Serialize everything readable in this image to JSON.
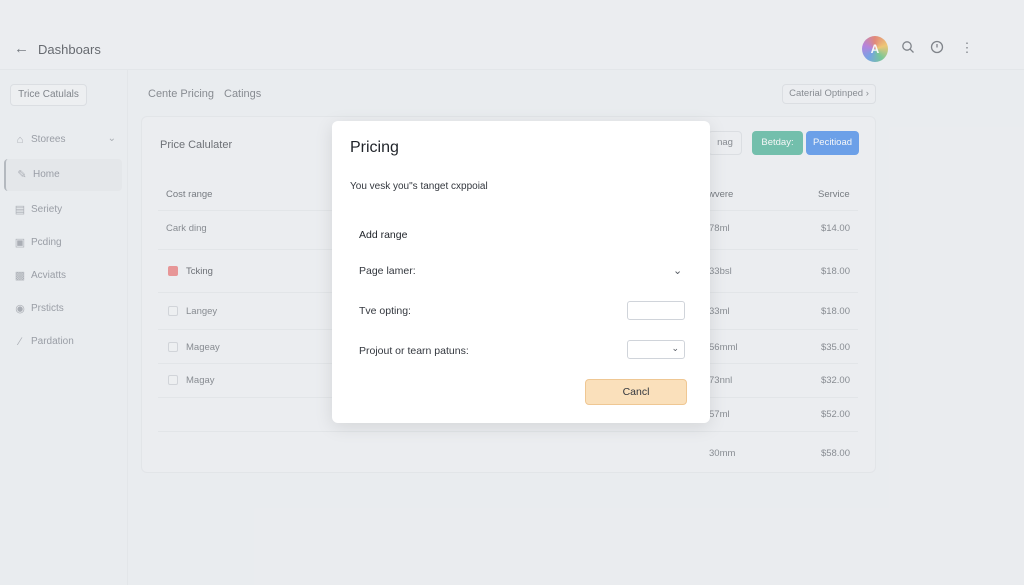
{
  "header": {
    "title": "Dashboars",
    "avatar_letter": "A",
    "icons": [
      "back-arrow-icon",
      "search-icon",
      "clock-icon",
      "more-vertical-icon"
    ]
  },
  "sidebar": {
    "search_label": "Trice Catulals",
    "items": [
      {
        "label": "Storees",
        "icon": "home-icon",
        "has_chevron": true
      },
      {
        "label": "Home",
        "icon": "pencil-icon",
        "active": true
      },
      {
        "label": "Seriety",
        "icon": "document-icon"
      },
      {
        "label": "Pcding",
        "icon": "calendar-icon"
      },
      {
        "label": "Acviatts",
        "icon": "chart-icon"
      },
      {
        "label": "Prsticts",
        "icon": "users-icon"
      },
      {
        "label": "Pardation",
        "icon": "wrench-icon"
      }
    ]
  },
  "subtabs": [
    "Cente Pricing",
    "Catings"
  ],
  "breadcrumb_button": "Caterial Optinped",
  "card": {
    "title": "Price Calulater",
    "buttons": {
      "ghost": "nag",
      "teal": "Betday:",
      "blue": "Pecitioad"
    },
    "columns": {
      "left": "Cost range",
      "middle": "wvere",
      "right": "Service"
    },
    "rows": [
      {
        "label": "Cark ding",
        "mid": "78ml",
        "price": "$14.00",
        "checkbox": "none"
      },
      {
        "label": "Tcking",
        "mid": "33bsl",
        "price": "$18.00",
        "checkbox": "red"
      },
      {
        "label": "Langey",
        "mid": "33ml",
        "price": "$18.00",
        "checkbox": "empty"
      },
      {
        "label": "Mageay",
        "mid": "56mml",
        "price": "$35.00",
        "checkbox": "empty"
      },
      {
        "label": "Magay",
        "mid": "73nnl",
        "price": "$32.00",
        "checkbox": "empty"
      },
      {
        "label": "",
        "mid": "57ml",
        "price": "$52.00",
        "checkbox": "none"
      },
      {
        "label": "",
        "mid": "30mm",
        "price": "$58.00",
        "checkbox": "none"
      }
    ]
  },
  "modal": {
    "title": "Pricing",
    "description": "You vesk you\"s tanget cxppoial",
    "section": "Add range",
    "fields": [
      {
        "label": "Page lamer:",
        "type": "dropdown-chevron"
      },
      {
        "label": "Tve opting:",
        "type": "text-input",
        "value": ""
      },
      {
        "label": "Projout or tearn patuns:",
        "type": "select",
        "value": ""
      }
    ],
    "cancel_label": "Cancl"
  },
  "colors": {
    "teal_button": "#37a98a",
    "blue_button": "#2b7ae6",
    "cancel_button": "#fae0bb",
    "checkbox_red": "#e86a6a"
  }
}
